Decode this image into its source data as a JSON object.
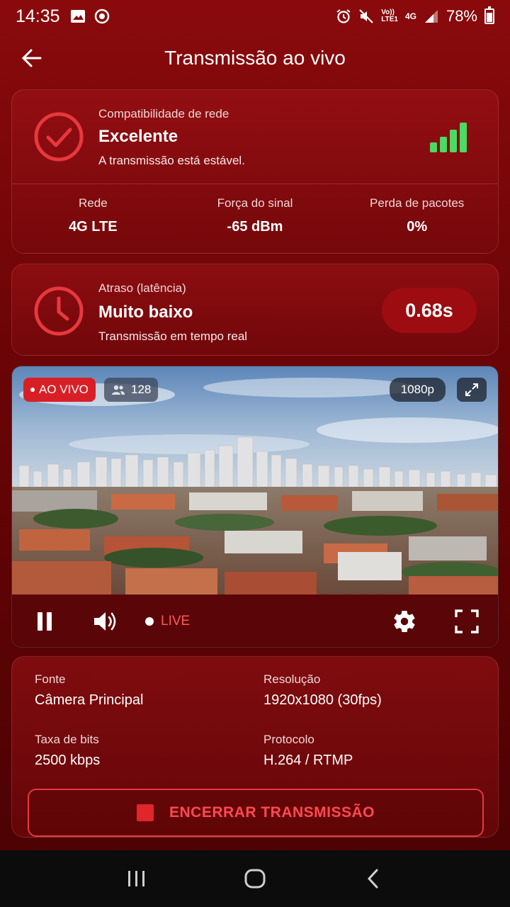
{
  "status_bar": {
    "time": "14:35",
    "network_top": "Vo))",
    "network_bottom": "LTE1",
    "gen": "4G",
    "battery": "78%"
  },
  "header": {
    "title": "Transmissão ao vivo"
  },
  "compat": {
    "label": "Compatibilidade de rede",
    "value": "Excelente",
    "desc": "A transmissão está estável.",
    "signal_level": 4,
    "signal_color": "#4cd964"
  },
  "stats": [
    {
      "label": "Rede",
      "value": "4G LTE"
    },
    {
      "label": "Força do sinal",
      "value": "-65 dBm"
    },
    {
      "label": "Perda de pacotes",
      "value": "0%"
    }
  ],
  "latency": {
    "label": "Atraso (latência)",
    "value": "Muito baixo",
    "desc": "Transmissão em tempo real",
    "time": "0.68s"
  },
  "video": {
    "live_badge": "AO VIVO",
    "viewers": "128",
    "resolution": "1080p",
    "live_indicator": "LIVE"
  },
  "info": {
    "source_label": "Fonte",
    "source_value": "Câmera Principal",
    "resolution_label": "Resolução",
    "resolution_value": "1920x1080 (30fps)",
    "bitrate_label": "Taxa de bits",
    "bitrate_value": "2500 kbps",
    "protocol_label": "Protocolo",
    "protocol_value": "H.264 / RTMP"
  },
  "end_button": {
    "label": "ENCERRAR TRANSMISSÃO"
  },
  "colors": {
    "accent": "#e0252b",
    "live_red": "#d91f26",
    "signal_green": "#4cd964"
  }
}
